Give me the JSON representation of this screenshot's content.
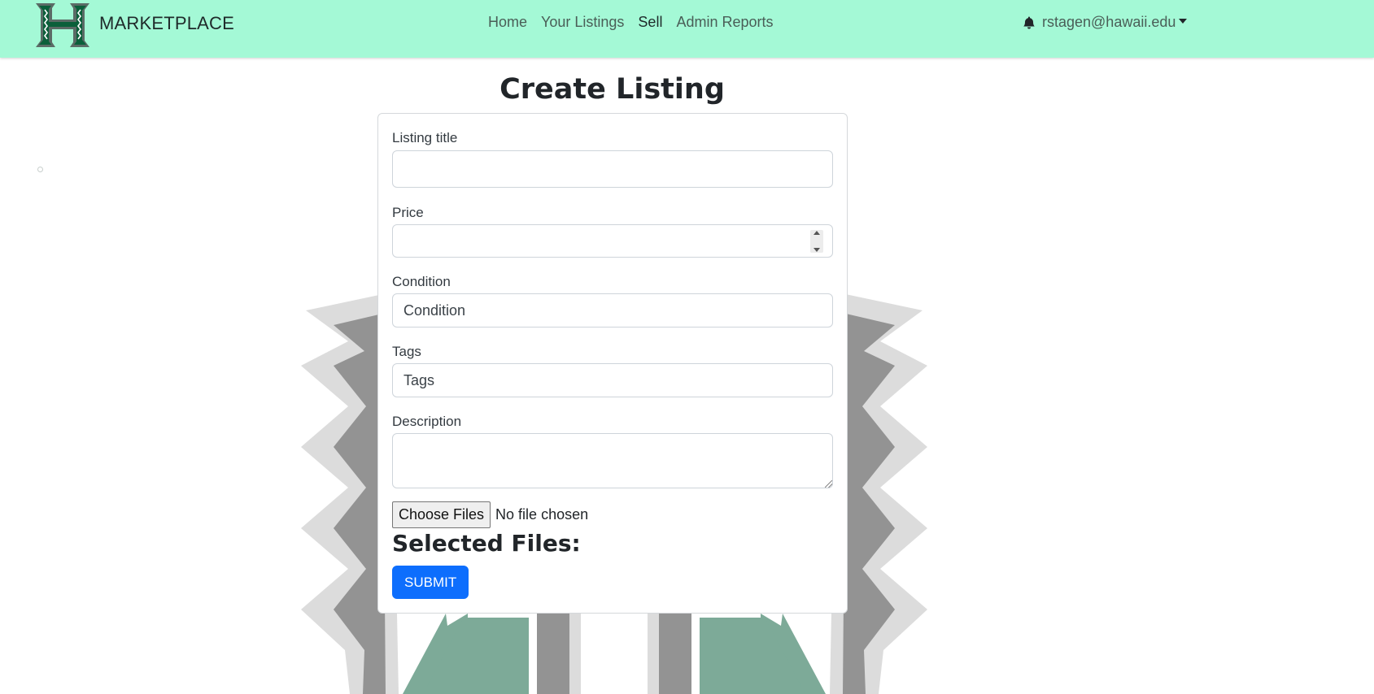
{
  "navbar": {
    "brand": "MARKETPLACE",
    "logo_icon": "uh-h-logo-icon",
    "links": [
      {
        "label": "Home",
        "active": false
      },
      {
        "label": "Your Listings",
        "active": false
      },
      {
        "label": "Sell",
        "active": true
      },
      {
        "label": "Admin Reports",
        "active": false
      }
    ],
    "user": {
      "email": "rstagen@hawaii.edu",
      "notification_icon": "bell-icon"
    },
    "background_color": "#a4f9d6"
  },
  "page": {
    "title": "Create Listing"
  },
  "form": {
    "title_label": "Listing title",
    "title_value": "",
    "price_label": "Price",
    "price_value": "",
    "condition_label": "Condition",
    "condition_value": "Condition",
    "tags_label": "Tags",
    "tags_value": "Tags",
    "description_label": "Description",
    "description_value": "",
    "file_button": "Choose Files",
    "file_status": "No file chosen",
    "selected_files_heading": "Selected Files:",
    "submit_label": "SUBMIT",
    "submit_color": "#0d6efd"
  }
}
